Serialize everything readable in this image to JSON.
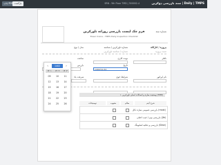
{
  "topbar": {
    "title": "سند بازرسی دوکرین | Daily | TMPS",
    "subtitle": "SRN - 5th Floor TMD | 300002-4",
    "print_label": "چاپ PDF",
    "back_label": "بازگشت"
  },
  "form": {
    "title": "فرم چک لیست بازرسی روزانه تاورکرین",
    "subtitle": "Tower Crane - TMPS Daily Inspection Checklist",
    "doc_number_label": "شماره سند",
    "project_label": "پروژه / کارگاه",
    "project_value": "تست پروژه",
    "crane_no_label": "شماره تاورکرین / شناسه",
    "crane_no_value": "شماره / شناسه تاورکرین",
    "model_label": "مدل / نوع",
    "model_value": "",
    "supervisor_label": "ناظر",
    "supervisor_value": "",
    "date_label": "تاریخ",
    "date_value": "1402/11/12",
    "time_label": "ساعت",
    "shift_label": "نوبت کاری",
    "operator_label": "نام اپراتور",
    "inspector_label": "بازرس",
    "weather_label": "شرایط جوی",
    "wind_label": "سرعت باد",
    "section_title": "۱. وضعیت سازه و اتصالات اصلی تاورکرین (TMP)"
  },
  "table": {
    "col_item": "شرح آیتم",
    "col_ok": "سالم",
    "col_nok": "معیوب",
    "col_note": "توضیحات",
    "rows": [
      {
        "item": "بازرسی عمومی سازه دکل (mast)"
      },
      {
        "item": "بازرسی بوم / جیب اصلی (Jib)"
      },
      {
        "item": "بازرسی و تخلیه اسلوینگ (Slew)"
      }
    ]
  },
  "datepicker": {
    "prev_icon": "chevron-left-icon",
    "next_icon": "chevron-right-icon",
    "year": "1402",
    "headers": [
      "۱۴۰۱",
      "۱۴۰۲",
      "۱۴۰۳"
    ],
    "cells": [
      "09",
      "10",
      "11",
      "12",
      "13",
      "14",
      "15",
      "16",
      "17",
      "18",
      "19",
      "20",
      "21",
      "22",
      "23",
      "24",
      "25",
      "26"
    ]
  },
  "colors": {
    "accent": "#3c7bd0",
    "topbar": "#2f353b"
  }
}
